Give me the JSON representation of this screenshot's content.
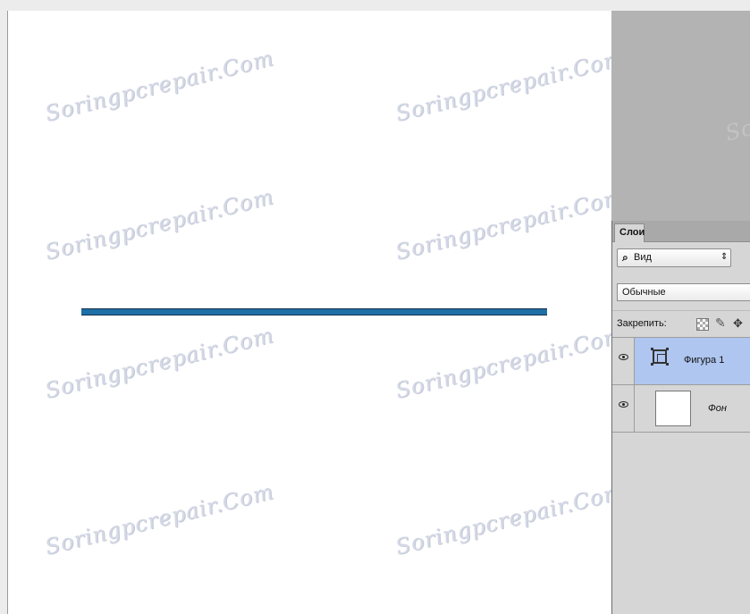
{
  "watermark": "Soringpcrepair.Com",
  "layers_panel": {
    "tab_label": "Слои",
    "filter_label": "Вид",
    "blend_mode": "Обычные",
    "lock_label": "Закрепить:",
    "layers": [
      {
        "name": "Фигура 1",
        "selected": true,
        "kind": "shape",
        "visible": true
      },
      {
        "name": "Фон",
        "selected": false,
        "kind": "background",
        "visible": true
      }
    ]
  },
  "colors": {
    "line_shape": "#1e6fa6",
    "selected_layer": "#aec6f0",
    "workspace_bg": "#b3b3b3"
  },
  "icons": [
    "search-icon",
    "updown-arrows-icon",
    "lock-transparency-icon",
    "brush-icon",
    "move-icon",
    "eye-icon",
    "shape-layer-icon"
  ]
}
